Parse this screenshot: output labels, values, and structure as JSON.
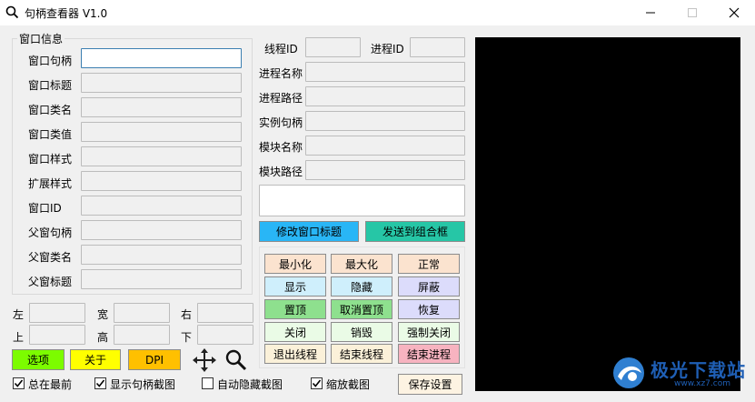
{
  "window": {
    "title": "句柄查看器 V1.0"
  },
  "info_group": {
    "title": "窗口信息",
    "rows": [
      {
        "label": "窗口句柄",
        "value": ""
      },
      {
        "label": "窗口标题",
        "value": ""
      },
      {
        "label": "窗口类名",
        "value": ""
      },
      {
        "label": "窗口类值",
        "value": ""
      },
      {
        "label": "窗口样式",
        "value": ""
      },
      {
        "label": "扩展样式",
        "value": ""
      },
      {
        "label": "窗口ID",
        "value": ""
      },
      {
        "label": "父窗句柄",
        "value": ""
      },
      {
        "label": "父窗类名",
        "value": ""
      },
      {
        "label": "父窗标题",
        "value": ""
      }
    ]
  },
  "rect": {
    "left_label": "左",
    "width_label": "宽",
    "right_label": "右",
    "top_label": "上",
    "height_label": "高",
    "bottom_label": "下"
  },
  "process": {
    "thread_id_label": "线程ID",
    "process_id_label": "进程ID",
    "rows": [
      {
        "label": "进程名称",
        "value": ""
      },
      {
        "label": "进程路径",
        "value": ""
      },
      {
        "label": "实例句柄",
        "value": ""
      },
      {
        "label": "模块名称",
        "value": ""
      },
      {
        "label": "模块路径",
        "value": ""
      }
    ]
  },
  "actions": {
    "modify_title": "修改窗口标题",
    "send_to_combo": "发送到组合框"
  },
  "grid_buttons": [
    [
      "最小化",
      "最大化",
      "正常"
    ],
    [
      "显示",
      "隐藏",
      "屏蔽"
    ],
    [
      "置顶",
      "取消置顶",
      "恢复"
    ],
    [
      "关闭",
      "销毁",
      "强制关闭"
    ],
    [
      "退出线程",
      "结束线程",
      "结束进程"
    ]
  ],
  "grid_colors": [
    [
      "#fbe3cf",
      "#fbe3cf",
      "#fbe3cf"
    ],
    [
      "#cfeffc",
      "#cfeffc",
      "#dcdcfb"
    ],
    [
      "#8ee08e",
      "#8ee08e",
      "#dcdcfb"
    ],
    [
      "#eafbe6",
      "#eafbe6",
      "#eafbe6"
    ],
    [
      "#fbf1d9",
      "#fbf1d9",
      "#f7b3c0"
    ]
  ],
  "bottom_buttons": {
    "options": "选项",
    "about": "关于",
    "dpi": "DPI",
    "save_settings": "保存设置"
  },
  "checkboxes": [
    {
      "label": "总在最前",
      "checked": true
    },
    {
      "label": "显示句柄截图",
      "checked": true
    },
    {
      "label": "自动隐藏截图",
      "checked": false
    },
    {
      "label": "缩放截图",
      "checked": true
    }
  ],
  "colors": {
    "options_bg": "#7cfc00",
    "about_bg": "#ffff00",
    "dpi_bg": "#ffc000",
    "modify_title_bg": "#29b6f6",
    "send_combo_bg": "#26c6a6"
  },
  "watermark": {
    "text": "极光下载站",
    "subtext": "www.xz7.com"
  }
}
